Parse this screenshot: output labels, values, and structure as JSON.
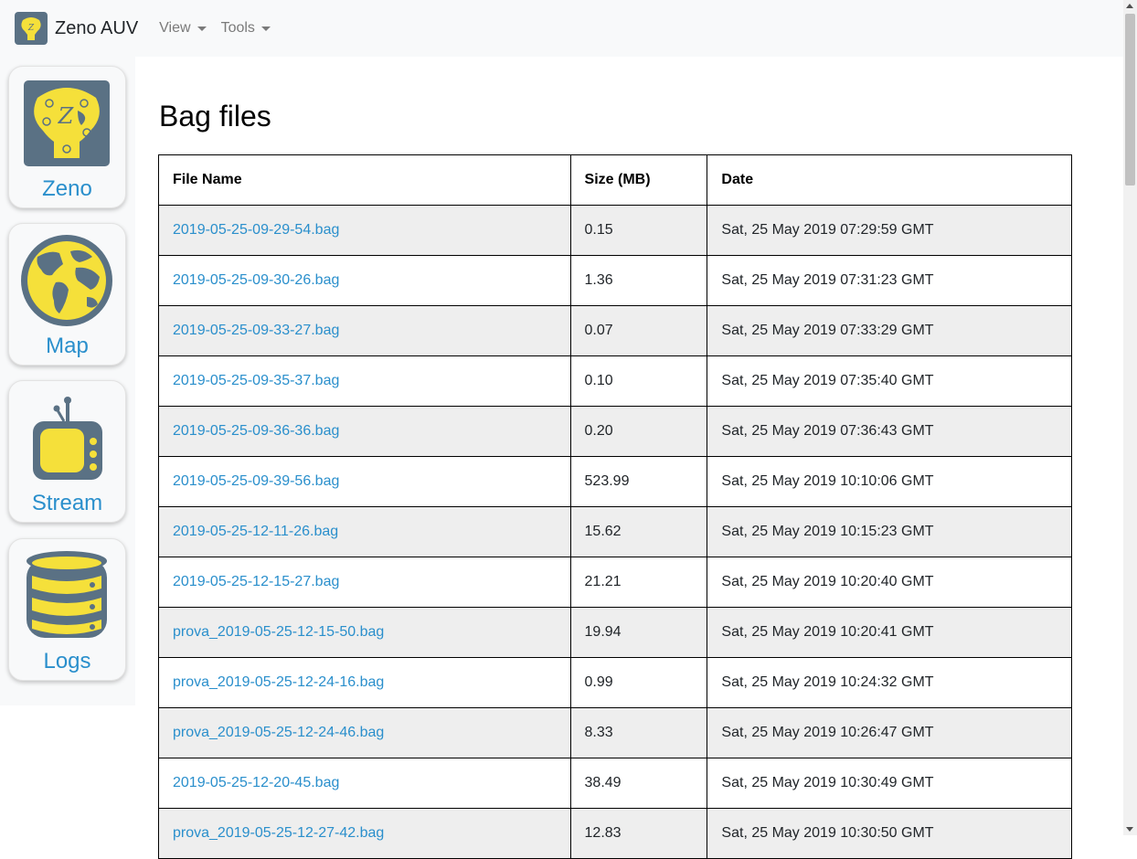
{
  "navbar": {
    "brand": "Zeno AUV",
    "menus": [
      {
        "label": "View",
        "icon": "chevron-down-icon"
      },
      {
        "label": "Tools",
        "icon": "chevron-down-icon"
      }
    ]
  },
  "sidebar": {
    "items": [
      {
        "label": "Zeno",
        "icon": "zeno-logo-icon"
      },
      {
        "label": "Map",
        "icon": "globe-icon"
      },
      {
        "label": "Stream",
        "icon": "tv-icon"
      },
      {
        "label": "Logs",
        "icon": "database-icon"
      }
    ]
  },
  "main": {
    "title": "Bag files",
    "columns": [
      "File Name",
      "Size (MB)",
      "Date"
    ],
    "rows": [
      {
        "name": "2019-05-25-09-29-54.bag",
        "size": "0.15",
        "date": "Sat, 25 May 2019 07:29:59 GMT"
      },
      {
        "name": "2019-05-25-09-30-26.bag",
        "size": "1.36",
        "date": "Sat, 25 May 2019 07:31:23 GMT"
      },
      {
        "name": "2019-05-25-09-33-27.bag",
        "size": "0.07",
        "date": "Sat, 25 May 2019 07:33:29 GMT"
      },
      {
        "name": "2019-05-25-09-35-37.bag",
        "size": "0.10",
        "date": "Sat, 25 May 2019 07:35:40 GMT"
      },
      {
        "name": "2019-05-25-09-36-36.bag",
        "size": "0.20",
        "date": "Sat, 25 May 2019 07:36:43 GMT"
      },
      {
        "name": "2019-05-25-09-39-56.bag",
        "size": "523.99",
        "date": "Sat, 25 May 2019 10:10:06 GMT"
      },
      {
        "name": "2019-05-25-12-11-26.bag",
        "size": "15.62",
        "date": "Sat, 25 May 2019 10:15:23 GMT"
      },
      {
        "name": "2019-05-25-12-15-27.bag",
        "size": "21.21",
        "date": "Sat, 25 May 2019 10:20:40 GMT"
      },
      {
        "name": "prova_2019-05-25-12-15-50.bag",
        "size": "19.94",
        "date": "Sat, 25 May 2019 10:20:41 GMT"
      },
      {
        "name": "prova_2019-05-25-12-24-16.bag",
        "size": "0.99",
        "date": "Sat, 25 May 2019 10:24:32 GMT"
      },
      {
        "name": "prova_2019-05-25-12-24-46.bag",
        "size": "8.33",
        "date": "Sat, 25 May 2019 10:26:47 GMT"
      },
      {
        "name": "2019-05-25-12-20-45.bag",
        "size": "38.49",
        "date": "Sat, 25 May 2019 10:30:49 GMT"
      },
      {
        "name": "prova_2019-05-25-12-27-42.bag",
        "size": "12.83",
        "date": "Sat, 25 May 2019 10:30:50 GMT"
      }
    ]
  },
  "colors": {
    "accent": "#2a8fcc",
    "icon_yellow": "#f5e03a",
    "icon_slate": "#5a7184",
    "row_stripe": "#eeeeee"
  }
}
